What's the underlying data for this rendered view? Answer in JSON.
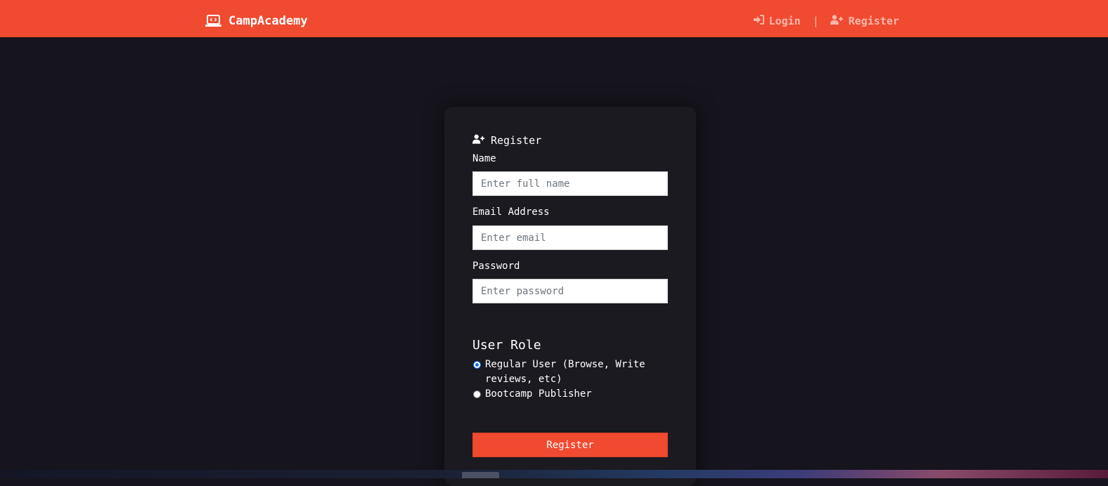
{
  "navbar": {
    "brand": "CampAcademy",
    "brand_icon": "laptop-code-icon",
    "links": [
      {
        "label": "Login",
        "icon": "sign-in-icon"
      },
      {
        "label": "Register",
        "icon": "user-plus-icon"
      }
    ],
    "separator": "|",
    "color": "#f04a30"
  },
  "form": {
    "title": "Register",
    "title_icon": "user-plus-icon",
    "fields": [
      {
        "label": "Name",
        "placeholder": "Enter full name",
        "value": ""
      },
      {
        "label": "Email Address",
        "placeholder": "Enter email",
        "value": ""
      },
      {
        "label": "Password",
        "placeholder": "Enter password",
        "value": ""
      }
    ],
    "role_heading": "User Role",
    "roles": [
      {
        "label": "Regular User (Browse, Write reviews, etc)",
        "checked": true
      },
      {
        "label": "Bootcamp Publisher",
        "checked": false
      }
    ],
    "submit_label": "Register"
  },
  "colors": {
    "accent": "#f04a30",
    "background": "#16141d",
    "card": "#1b1a21"
  }
}
